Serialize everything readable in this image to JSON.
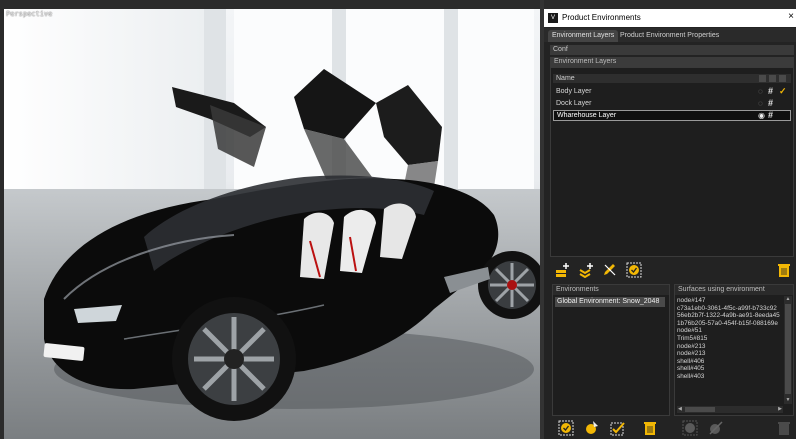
{
  "viewport": {
    "label": "Perspective"
  },
  "window": {
    "title": "Product Environments",
    "app_icon": "vred-app-icon",
    "close_glyph": "×"
  },
  "tabs": [
    {
      "label": "Environment Layers",
      "active": true
    },
    {
      "label": "Product Environment Properties",
      "active": false
    }
  ],
  "conf_label": "Conf",
  "layers": {
    "group_title": "Environment Layers",
    "column_header": "Name",
    "rows": [
      {
        "name": "Body Layer",
        "visibility_icon": "eye-hidden-icon",
        "hash": "#",
        "active": true
      },
      {
        "name": "Dock Layer",
        "visibility_icon": "eye-hidden-icon",
        "hash": "#",
        "active": false
      },
      {
        "name": "Wharehouse Layer",
        "visibility_icon": "eye-icon",
        "hash": "#",
        "active": false
      }
    ],
    "toolbar_icons": [
      "add-layer-icon",
      "add-sublayer-icon",
      "edit-layer-icon",
      "apply-layer-icon",
      "delete-icon"
    ]
  },
  "environments": {
    "title": "Environments",
    "items": [
      "Global Environment: Snow_2048"
    ],
    "toolbar_icons": [
      "select-environment-icon",
      "assign-environment-icon",
      "apply-environment-icon",
      "delete-environment-icon"
    ]
  },
  "surfaces": {
    "title": "Surfaces using environment",
    "items": [
      "node#147",
      "c73a1eb0-3061-4f5c-a99f-b733c92",
      "56eb2b7f-1322-4a9b-ae91-8eeda45",
      "1b76b205-57a0-454f-b15f-088169e",
      "node#51",
      "Trim5#815",
      "node#213",
      "node#213",
      "shell#406",
      "shell#405",
      "shell#403"
    ],
    "toolbar_icons": [
      "select-surface-icon",
      "unassign-surface-icon",
      "delete-surface-icon"
    ]
  },
  "colors": {
    "accent": "#f2b705",
    "panel_bg": "#232323",
    "selection_border": "#9a9a9a"
  }
}
